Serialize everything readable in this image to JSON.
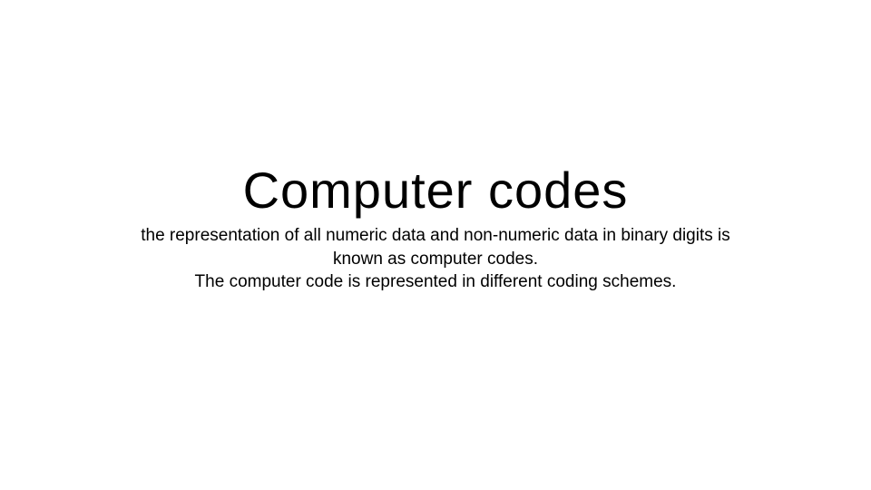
{
  "slide": {
    "title": "Computer codes",
    "body_line1": "the representation of all numeric data and non-numeric data in binary digits is",
    "body_line2": "known as computer codes.",
    "body_line3": "The computer code is represented in different coding schemes."
  }
}
